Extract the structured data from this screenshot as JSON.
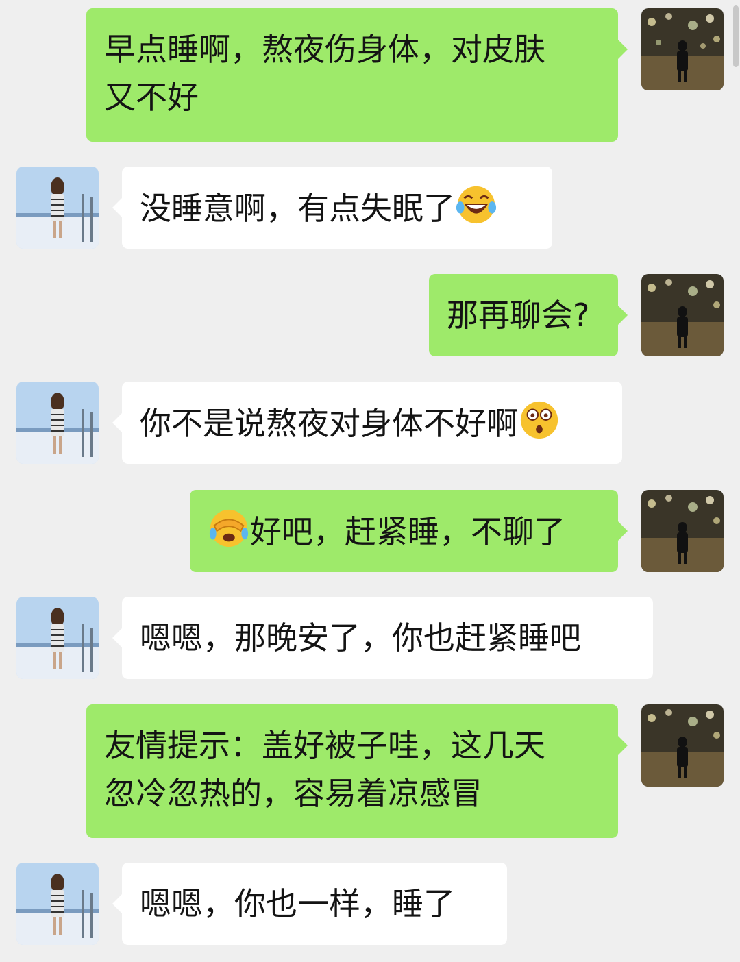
{
  "messages": [
    {
      "sender": "me",
      "lines": [
        "早点睡啊，熬夜伤身体，对皮肤",
        "又不好"
      ]
    },
    {
      "sender": "them",
      "text": "没睡意啊，有点失眠了",
      "emoji_after": "laughing-tears-emoji"
    },
    {
      "sender": "me",
      "text": "那再聊会?"
    },
    {
      "sender": "them",
      "text": "你不是说熬夜对身体不好啊",
      "emoji_after": "surprised-face-emoji"
    },
    {
      "sender": "me",
      "emoji_before": "facepalm-emoji",
      "text": "好吧，赶紧睡，不聊了"
    },
    {
      "sender": "them",
      "text": "嗯嗯，那晚安了，你也赶紧睡吧"
    },
    {
      "sender": "me",
      "lines": [
        "友情提示：盖好被子哇，这几天",
        "忽冷忽热的，容易着凉感冒"
      ]
    },
    {
      "sender": "them",
      "text": "嗯嗯，你也一样，睡了"
    }
  ],
  "colors": {
    "background": "#efefef",
    "my_bubble": "#9eea6a",
    "their_bubble": "#ffffff",
    "text": "#141414"
  },
  "avatars": {
    "me": "night-lights-person-avatar",
    "them": "snowy-rail-girl-avatar"
  }
}
